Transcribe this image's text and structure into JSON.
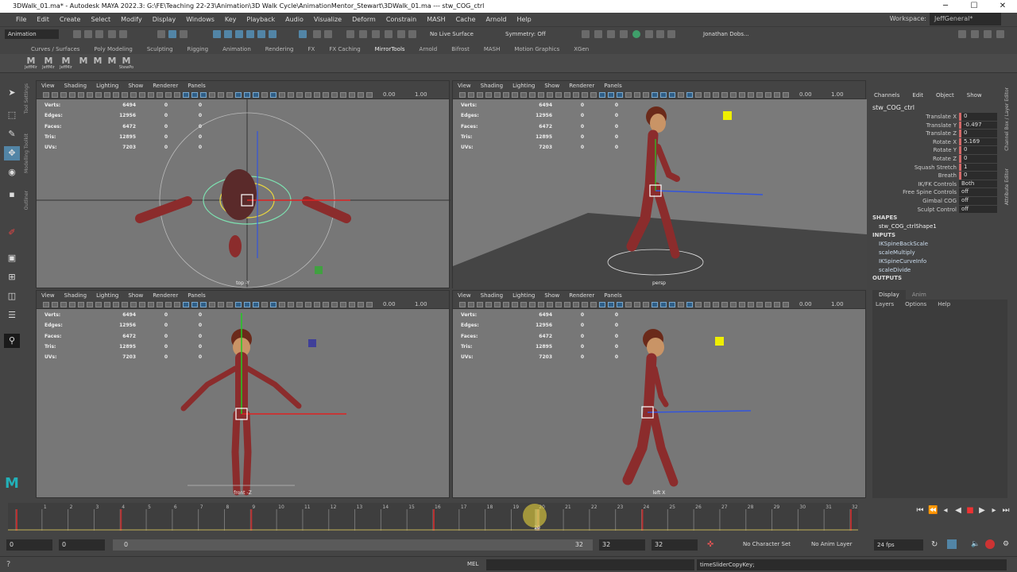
{
  "window": {
    "title": "3DWalk_01.ma* - Autodesk MAYA 2022.3: G:\\FE\\Teaching 22-23\\Animation\\3D Walk Cycle\\AnimationMentor_Stewart\\3DWalk_01.ma  ---  stw_COG_ctrl",
    "min": "─",
    "max": "☐",
    "close": "✕"
  },
  "menubar": [
    "File",
    "Edit",
    "Create",
    "Select",
    "Modify",
    "Display",
    "Windows",
    "Key",
    "Playback",
    "Audio",
    "Visualize",
    "Deform",
    "Constrain",
    "MASH",
    "Cache",
    "Arnold",
    "Help"
  ],
  "workspace": {
    "label": "Workspace:",
    "value": "JeffGeneral*"
  },
  "statusline": {
    "menuset": "Animation",
    "live_surface": "No Live Surface",
    "symmetry": "Symmetry: Off",
    "user": "Jonathan Dobs..."
  },
  "shelf": {
    "tabs": [
      "Curves / Surfaces",
      "Poly Modeling",
      "Sculpting",
      "Rigging",
      "Animation",
      "Rendering",
      "FX",
      "FX Caching",
      "MirrorTools",
      "Arnold",
      "Bifrost",
      "MASH",
      "Motion Graphics",
      "XGen"
    ],
    "active_tab": "MirrorTools",
    "icons": [
      "JeffMir",
      "JeffMir",
      "JeffMir",
      "",
      "",
      "",
      "",
      "StewPo"
    ]
  },
  "sidelabels": [
    "Tool Settings",
    "Modelling Toolkit",
    "Outliner"
  ],
  "viewport_menu": [
    "View",
    "Shading",
    "Lighting",
    "Show",
    "Renderer",
    "Panels"
  ],
  "viewport_fields": {
    "a": "0.00",
    "b": "1.00"
  },
  "hud": [
    {
      "k": "Verts:",
      "a": "6494",
      "b": "0",
      "c": "0"
    },
    {
      "k": "Edges:",
      "a": "12956",
      "b": "0",
      "c": "0"
    },
    {
      "k": "Faces:",
      "a": "6472",
      "b": "0",
      "c": "0"
    },
    {
      "k": "Tris:",
      "a": "12895",
      "b": "0",
      "c": "0"
    },
    {
      "k": "UVs:",
      "a": "7203",
      "b": "0",
      "c": "0"
    }
  ],
  "cameras": {
    "top": "top -Y",
    "persp": "persp",
    "front": "front -Z",
    "left": "left X"
  },
  "channelbox": {
    "tabs": [
      "Channels",
      "Edit",
      "Object",
      "Show"
    ],
    "object": "stw_COG_ctrl",
    "attrs": [
      {
        "name": "Translate X",
        "value": "0",
        "key": true
      },
      {
        "name": "Translate Y",
        "value": "-0.497",
        "key": true
      },
      {
        "name": "Translate Z",
        "value": "0",
        "key": true
      },
      {
        "name": "Rotate X",
        "value": "5.169",
        "key": true
      },
      {
        "name": "Rotate Y",
        "value": "0",
        "key": true
      },
      {
        "name": "Rotate Z",
        "value": "0",
        "key": true
      },
      {
        "name": "Squash Stretch",
        "value": "1",
        "key": true
      },
      {
        "name": "Breath",
        "value": "0",
        "key": true
      },
      {
        "name": "IK/FK Controls",
        "value": "Both",
        "key": false
      },
      {
        "name": "Free Spine Controls",
        "value": "off",
        "key": false
      },
      {
        "name": "Gimbal COG",
        "value": "off",
        "key": false
      },
      {
        "name": "Sculpt Control",
        "value": "off",
        "key": false
      }
    ],
    "shapes_label": "SHAPES",
    "shapes": [
      "stw_COG_ctrlShape1"
    ],
    "inputs_label": "INPUTS",
    "inputs": [
      "IKSpineBackScale",
      "scaleMultiply",
      "IKSpineCurveInfo",
      "scaleDivide"
    ],
    "outputs_label": "OUTPUTS",
    "side_tabs": [
      "Channel Box / Layer Editor",
      "Attribute Editor"
    ]
  },
  "layerpanel": {
    "tabs": [
      "Display",
      "Anim"
    ],
    "menus": [
      "Layers",
      "Options",
      "Help"
    ]
  },
  "timeline": {
    "frame_labels": [
      "1",
      "2",
      "3",
      "4",
      "5",
      "6",
      "7",
      "8",
      "9",
      "10",
      "11",
      "12",
      "13",
      "14",
      "15",
      "16",
      "17",
      "18",
      "19",
      "20",
      "21",
      "22",
      "23",
      "24",
      "25",
      "26",
      "27",
      "28",
      "29",
      "30",
      "31",
      "32"
    ],
    "current_frame": "20",
    "current_frame_value": 20
  },
  "range": {
    "start": "0",
    "anim_start": "0",
    "range_start": "0",
    "range_end": "32",
    "end": "32",
    "anim_end": "32",
    "char_set": "No Character Set",
    "anim_layer": "No Anim Layer",
    "fps": "24 fps"
  },
  "cmdline": {
    "lang": "MEL",
    "feedback": "timeSliderCopyKey;"
  },
  "colors": {
    "accent": "#5285a6",
    "key": "#b83030",
    "viewport_bg": "#777777",
    "character": "#8b2c2c"
  }
}
